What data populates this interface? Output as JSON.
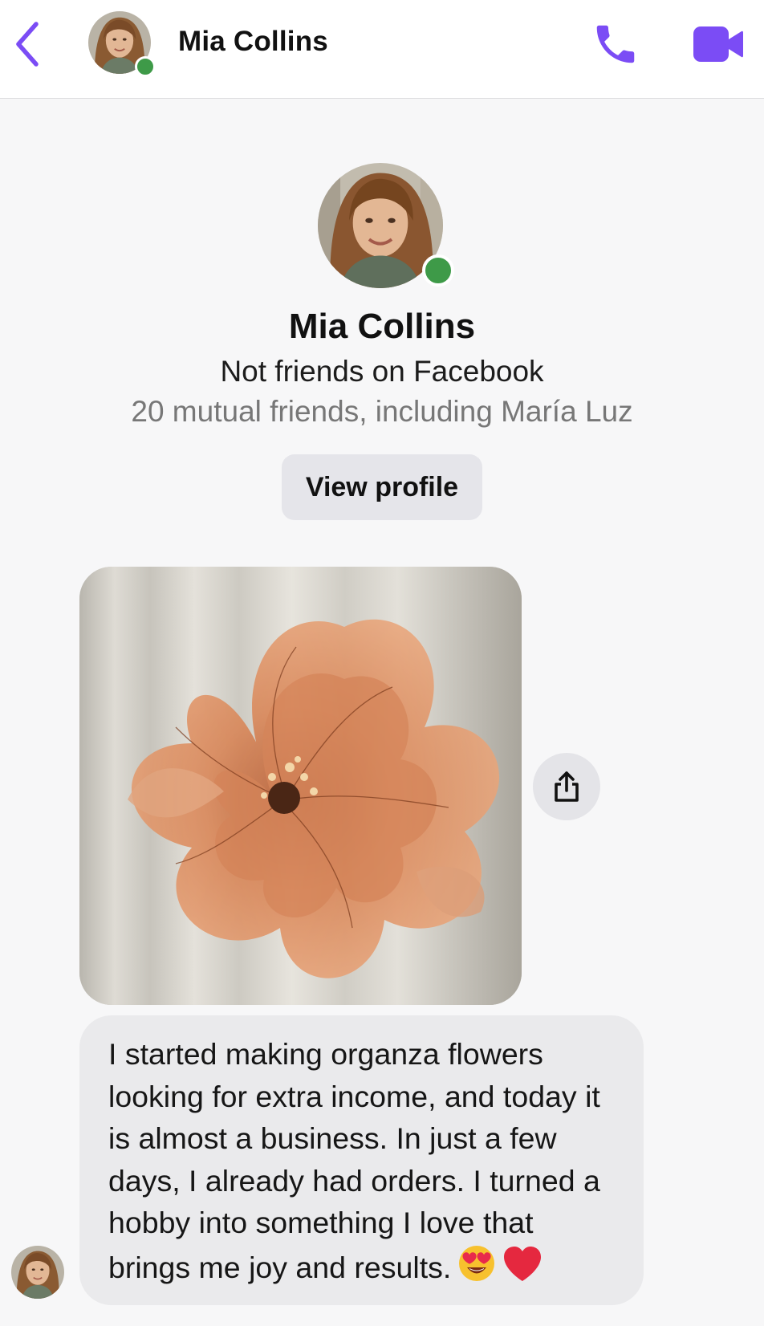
{
  "header": {
    "name": "Mia Collins",
    "online": true,
    "icons": {
      "back": "chevron-left-icon",
      "call": "phone-icon",
      "video": "video-camera-icon"
    }
  },
  "profile": {
    "name": "Mia Collins",
    "status": "Not friends on Facebook",
    "mutual": "20 mutual friends, including María Luz",
    "view_profile_label": "View profile"
  },
  "messages": [
    {
      "type": "image",
      "description_icon": "organza-flower-photo",
      "share_icon": "share-icon"
    },
    {
      "type": "text",
      "text": "I started making organza flowers looking for extra income, and today it is almost a business. In just a few days, I already had orders. I turned a hobby into something I love that brings me joy and results.",
      "emojis": [
        "heart-eyes-emoji",
        "red-heart-emoji"
      ]
    }
  ],
  "colors": {
    "accent": "#7b4cf5",
    "online": "#3e9a48",
    "bubble": "#eaeaec",
    "button": "#e5e5ea"
  }
}
